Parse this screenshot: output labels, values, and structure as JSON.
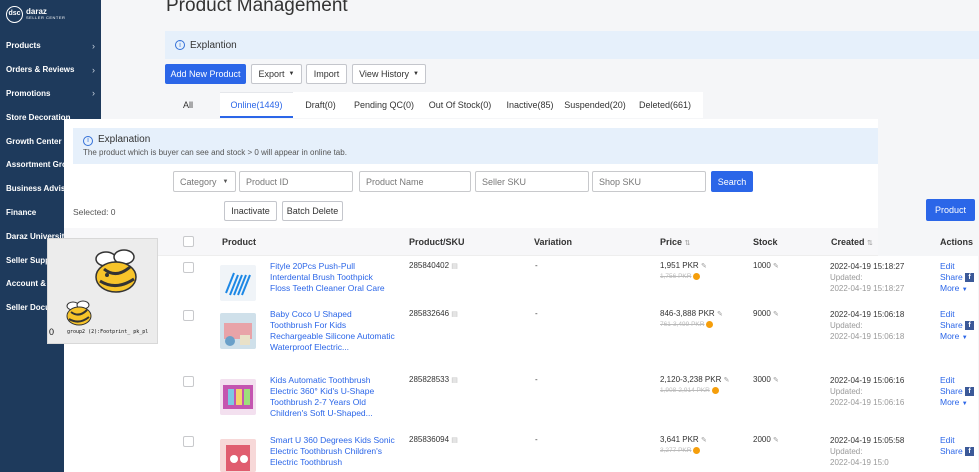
{
  "sidebar": {
    "logo": {
      "circle": "dsc",
      "line1": "daraz",
      "line2": "SELLER CENTER"
    },
    "items": [
      {
        "label": "Products",
        "chevron": true
      },
      {
        "label": "Orders & Reviews",
        "chevron": true
      },
      {
        "label": "Promotions",
        "chevron": true
      },
      {
        "label": "Store Decoration",
        "chevron": false
      },
      {
        "label": "Growth Center",
        "chevron": true
      },
      {
        "label": "Assortment Growth",
        "chevron": false
      },
      {
        "label": "Business Advisor",
        "chevron": false
      },
      {
        "label": "Finance",
        "chevron": true
      },
      {
        "label": "Daraz University",
        "chevron": false
      },
      {
        "label": "Seller Supp",
        "chevron": false
      },
      {
        "label": "Account & S",
        "chevron": false
      },
      {
        "label": "Seller Docu",
        "chevron": false
      }
    ]
  },
  "overlay": {
    "count": "0",
    "filename": "group2 (2):Footprint_ pk_pl"
  },
  "page": {
    "title": "Product Management"
  },
  "explanation_bar": {
    "label": "Explantion"
  },
  "toolbar": {
    "add_new": "Add New Product",
    "export": "Export",
    "import": "Import",
    "view_history": "View History"
  },
  "tabs": [
    "All",
    "Online(1449)",
    "Draft(0)",
    "Pending QC(0)",
    "Out Of Stock(0)",
    "Inactive(85)",
    "Suspended(20)",
    "Deleted(661)"
  ],
  "inner_explanation": {
    "title": "Explanation",
    "text": "The product which is buyer can see and stock > 0 will appear in online tab."
  },
  "filters": {
    "category": "Category",
    "product_id": "Product ID",
    "product_name": "Product Name",
    "seller_sku": "Seller SKU",
    "shop_sku": "Shop SKU",
    "search": "Search"
  },
  "bulk": {
    "selected": "Selected: 0",
    "inactivate": "Inactivate",
    "batch_delete": "Batch Delete",
    "product_btn": "Product"
  },
  "table": {
    "headers": {
      "product": "Product",
      "sku": "Product/SKU",
      "variation": "Variation",
      "price": "Price",
      "stock": "Stock",
      "created": "Created",
      "actions": "Actions"
    },
    "rows": [
      {
        "name": "Fityle 20Pcs Push-Pull Interdental Brush Toothpick Floss Teeth Cleaner Oral Care",
        "sku": "285840402",
        "variation": "-",
        "price": "1,951 PKR",
        "old_price": "1,756 PKR",
        "stock": "1000",
        "created": "2022-04-19 15:18:27",
        "updated_label": "Updated:",
        "updated": "2022-04-19 15:18:27",
        "edit": "Edit",
        "share": "Share",
        "more": "More"
      },
      {
        "name": "Baby Coco U Shaped Toothbrush For Kids Rechargeable Silicone Automatic Waterproof Electric...",
        "sku": "285832646",
        "variation": "-",
        "price": "846-3,888 PKR",
        "old_price": "761-3,499 PKR",
        "stock": "9000",
        "created": "2022-04-19 15:06:18",
        "updated_label": "Updated:",
        "updated": "2022-04-19 15:06:18",
        "edit": "Edit",
        "share": "Share",
        "more": "More"
      },
      {
        "name": "Kids Automatic Toothbrush Electric 360° Kid's U-Shape Toothbrush 2-7 Years Old Children's Soft U-Shaped...",
        "sku": "285828533",
        "variation": "-",
        "price": "2,120-3,238 PKR",
        "old_price": "1,908-2,914 PKR",
        "stock": "3000",
        "created": "2022-04-19 15:06:16",
        "updated_label": "Updated:",
        "updated": "2022-04-19 15:06:16",
        "edit": "Edit",
        "share": "Share",
        "more": "More"
      },
      {
        "name": "Smart U 360 Degrees Kids Sonic Electric Toothbrush Children's Electric Toothbrush",
        "sku": "285836094",
        "variation": "-",
        "price": "3,641 PKR",
        "old_price": "3,277 PKR",
        "stock": "2000",
        "created": "2022-04-19 15:05:58",
        "updated_label": "Updated:",
        "updated": "2022-04-19 15:0",
        "edit": "Edit",
        "share": "Share",
        "more": "More"
      }
    ]
  }
}
